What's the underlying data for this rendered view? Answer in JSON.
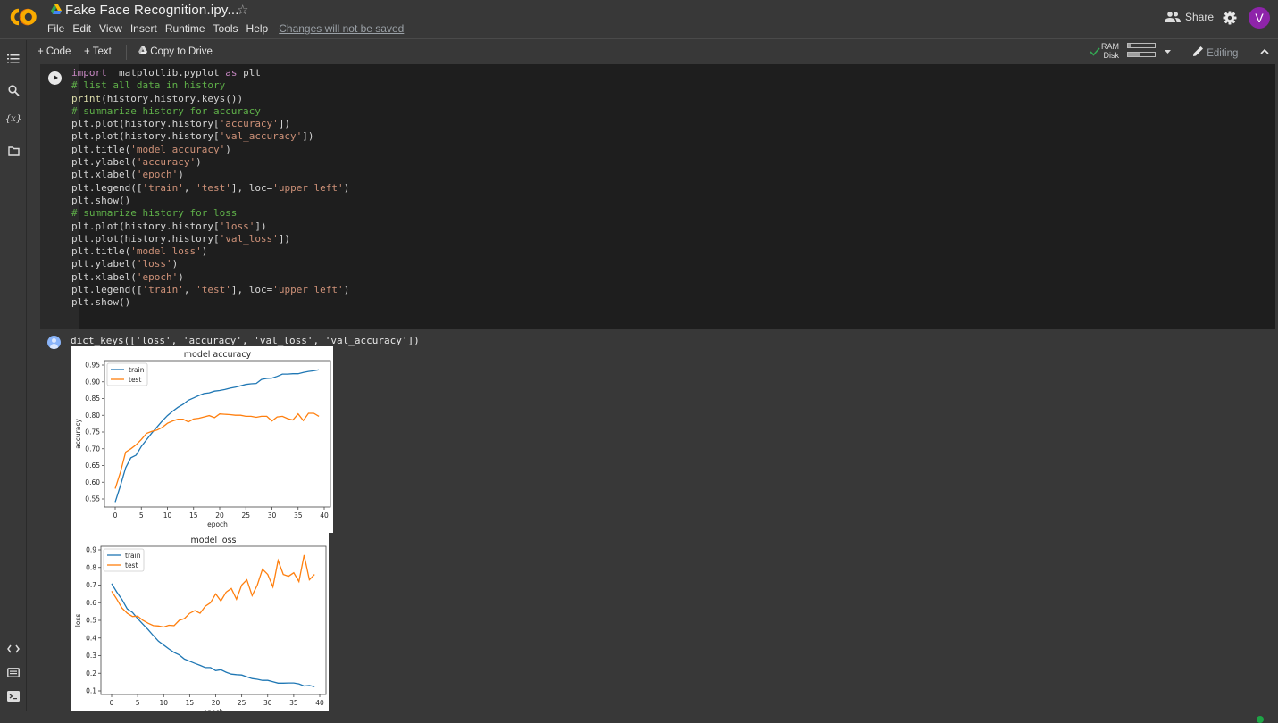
{
  "app": {
    "title": "Fake Face Recognition.ipy...",
    "menu": [
      "File",
      "Edit",
      "View",
      "Insert",
      "Runtime",
      "Tools",
      "Help"
    ],
    "unsaved_notice": "Changes will not be saved",
    "share_label": "Share",
    "avatar_letter": "V",
    "icons": {
      "logo": "colab-logo",
      "drive": "google-drive-icon",
      "star": "star-icon",
      "share": "people-icon",
      "settings": "gear-icon"
    }
  },
  "toolbar": {
    "add_code": "+ Code",
    "add_text": "+ Text",
    "copy_to_drive": "Copy to Drive",
    "ram_label": "RAM",
    "disk_label": "Disk",
    "ram_usage": 0.1,
    "disk_usage": 0.45,
    "editing_label": "Editing",
    "connected_status_color": "#34a853"
  },
  "sidebar": {
    "top_items": [
      "table-of-contents",
      "find-and-replace",
      "variables",
      "files"
    ],
    "bottom_items": [
      "code-snippets",
      "command-palette",
      "terminal"
    ]
  },
  "cell": {
    "code_lines": [
      [
        [
          "kw",
          "import"
        ],
        [
          "",
          "  matplotlib.pyplot "
        ],
        [
          "kw",
          "as"
        ],
        [
          "",
          " plt"
        ]
      ],
      [
        [
          "cm",
          "# list all data in history"
        ]
      ],
      [
        [
          "fn",
          "print"
        ],
        [
          "",
          "(history.history.keys())"
        ]
      ],
      [
        [
          "cm",
          "# summarize history for accuracy"
        ]
      ],
      [
        [
          "",
          "plt.plot(history.history["
        ],
        [
          "st",
          "'accuracy'"
        ],
        [
          "",
          "])"
        ]
      ],
      [
        [
          "",
          "plt.plot(history.history["
        ],
        [
          "st",
          "'val_accuracy'"
        ],
        [
          "",
          "])"
        ]
      ],
      [
        [
          "",
          "plt.title("
        ],
        [
          "st",
          "'model accuracy'"
        ],
        [
          "",
          ")"
        ]
      ],
      [
        [
          "",
          "plt.ylabel("
        ],
        [
          "st",
          "'accuracy'"
        ],
        [
          "",
          ")"
        ]
      ],
      [
        [
          "",
          "plt.xlabel("
        ],
        [
          "st",
          "'epoch'"
        ],
        [
          "",
          ")"
        ]
      ],
      [
        [
          "",
          "plt.legend(["
        ],
        [
          "st",
          "'train'"
        ],
        [
          "",
          ", "
        ],
        [
          "st",
          "'test'"
        ],
        [
          "",
          "], loc="
        ],
        [
          "st",
          "'upper left'"
        ],
        [
          "",
          ")"
        ]
      ],
      [
        [
          "",
          "plt.show()"
        ]
      ],
      [
        [
          "cm",
          "# summarize history for loss"
        ]
      ],
      [
        [
          "",
          "plt.plot(history.history["
        ],
        [
          "st",
          "'loss'"
        ],
        [
          "",
          "])"
        ]
      ],
      [
        [
          "",
          "plt.plot(history.history["
        ],
        [
          "st",
          "'val_loss'"
        ],
        [
          "",
          "])"
        ]
      ],
      [
        [
          "",
          "plt.title("
        ],
        [
          "st",
          "'model loss'"
        ],
        [
          "",
          ")"
        ]
      ],
      [
        [
          "",
          "plt.ylabel("
        ],
        [
          "st",
          "'loss'"
        ],
        [
          "",
          ")"
        ]
      ],
      [
        [
          "",
          "plt.xlabel("
        ],
        [
          "st",
          "'epoch'"
        ],
        [
          "",
          ")"
        ]
      ],
      [
        [
          "",
          "plt.legend(["
        ],
        [
          "st",
          "'train'"
        ],
        [
          "",
          ", "
        ],
        [
          "st",
          "'test'"
        ],
        [
          "",
          "], loc="
        ],
        [
          "st",
          "'upper left'"
        ],
        [
          "",
          ")"
        ]
      ],
      [
        [
          "",
          "plt.show()"
        ]
      ]
    ],
    "output_text": "dict_keys(['loss', 'accuracy', 'val_loss', 'val_accuracy'])"
  },
  "chart_data": [
    {
      "type": "line",
      "title": "model accuracy",
      "xlabel": "epoch",
      "ylabel": "accuracy",
      "xlim": [
        -2,
        41
      ],
      "ylim": [
        0.535,
        0.955
      ],
      "xticks": [
        0,
        5,
        10,
        15,
        20,
        25,
        30,
        35,
        40
      ],
      "yticks": [
        "0.55",
        "0.60",
        "0.65",
        "0.70",
        "0.75",
        "0.80",
        "0.85",
        "0.90",
        "0.95"
      ],
      "legend": "upper-left",
      "series": [
        {
          "name": "train",
          "color": "#1f77b4",
          "values": [
            0.541,
            0.59,
            0.643,
            0.673,
            0.681,
            0.707,
            0.727,
            0.747,
            0.765,
            0.783,
            0.799,
            0.812,
            0.824,
            0.833,
            0.845,
            0.852,
            0.859,
            0.865,
            0.867,
            0.872,
            0.874,
            0.877,
            0.881,
            0.884,
            0.888,
            0.892,
            0.894,
            0.895,
            0.907,
            0.91,
            0.911,
            0.916,
            0.923,
            0.923,
            0.924,
            0.924,
            0.928,
            0.931,
            0.933,
            0.936
          ]
        },
        {
          "name": "test",
          "color": "#ff7f0e",
          "values": [
            0.581,
            0.63,
            0.69,
            0.7,
            0.712,
            0.728,
            0.746,
            0.752,
            0.756,
            0.764,
            0.776,
            0.783,
            0.788,
            0.788,
            0.78,
            0.789,
            0.791,
            0.795,
            0.799,
            0.793,
            0.804,
            0.803,
            0.802,
            0.8,
            0.8,
            0.797,
            0.797,
            0.794,
            0.797,
            0.797,
            0.783,
            0.795,
            0.797,
            0.79,
            0.786,
            0.804,
            0.784,
            0.806,
            0.806,
            0.797
          ]
        }
      ]
    },
    {
      "type": "line",
      "title": "model loss",
      "xlabel": "epoch",
      "ylabel": "loss",
      "xlim": [
        -2,
        41
      ],
      "ylim": [
        0.09,
        0.91
      ],
      "xticks": [
        0,
        5,
        10,
        15,
        20,
        25,
        30,
        35,
        40
      ],
      "yticks": [
        "0.1",
        "0.2",
        "0.3",
        "0.4",
        "0.5",
        "0.6",
        "0.7",
        "0.8",
        "0.9"
      ],
      "legend": "upper-left",
      "series": [
        {
          "name": "train",
          "color": "#1f77b4",
          "values": [
            0.708,
            0.66,
            0.618,
            0.565,
            0.545,
            0.51,
            0.478,
            0.448,
            0.414,
            0.382,
            0.36,
            0.338,
            0.318,
            0.304,
            0.28,
            0.268,
            0.256,
            0.245,
            0.232,
            0.232,
            0.215,
            0.22,
            0.206,
            0.195,
            0.192,
            0.19,
            0.18,
            0.17,
            0.166,
            0.16,
            0.16,
            0.152,
            0.144,
            0.144,
            0.145,
            0.145,
            0.14,
            0.128,
            0.131,
            0.124
          ]
        },
        {
          "name": "test",
          "color": "#ff7f0e",
          "values": [
            0.665,
            0.62,
            0.57,
            0.54,
            0.522,
            0.524,
            0.5,
            0.484,
            0.47,
            0.468,
            0.462,
            0.472,
            0.47,
            0.5,
            0.51,
            0.54,
            0.555,
            0.54,
            0.58,
            0.6,
            0.65,
            0.61,
            0.66,
            0.68,
            0.62,
            0.7,
            0.73,
            0.64,
            0.7,
            0.79,
            0.76,
            0.69,
            0.84,
            0.76,
            0.75,
            0.77,
            0.72,
            0.87,
            0.73,
            0.76
          ]
        }
      ]
    }
  ]
}
